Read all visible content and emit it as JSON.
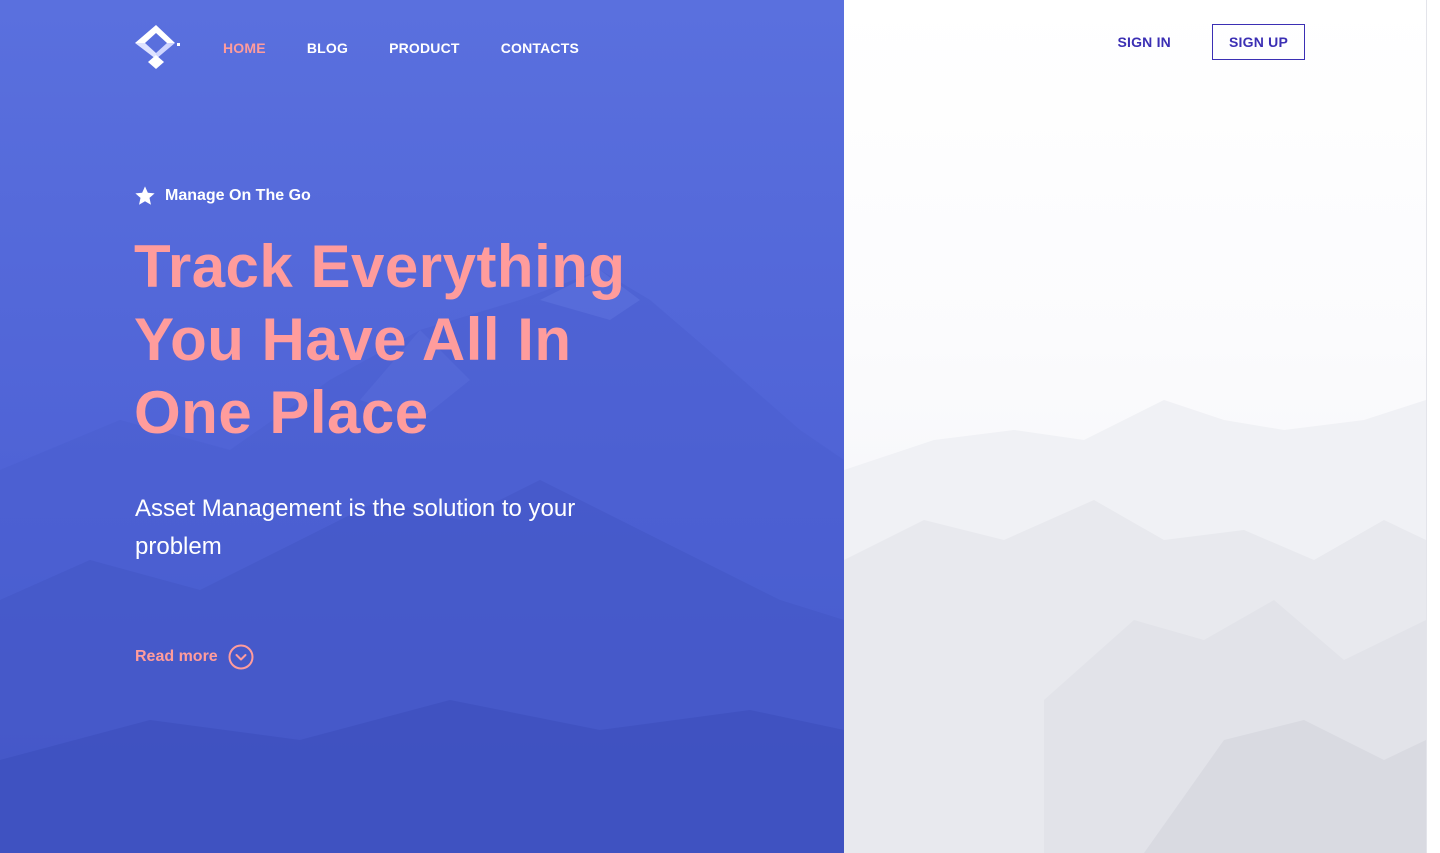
{
  "brand": {
    "logo_icon": "diamond-arrow-logo-icon"
  },
  "nav": {
    "items": [
      {
        "label": "HOME",
        "active": true
      },
      {
        "label": "BLOG",
        "active": false
      },
      {
        "label": "PRODUCT",
        "active": false
      },
      {
        "label": "CONTACTS",
        "active": false
      }
    ]
  },
  "auth": {
    "sign_in": "SIGN IN",
    "sign_up": "SIGN UP"
  },
  "hero": {
    "tagline": "Manage On The Go",
    "tagline_icon": "star-icon",
    "headline_lines": [
      "Track Everything",
      "You Have All In",
      "One Place"
    ],
    "subtitle": "Asset Management is the solution to your problem",
    "cta_label": "Read more",
    "cta_icon": "chevron-down-circle-icon"
  },
  "colors": {
    "accent": "#ff9c9c",
    "primary_blue": "#5068da",
    "auth_text": "#3b2fb4",
    "nav_text": "#ffffff"
  }
}
